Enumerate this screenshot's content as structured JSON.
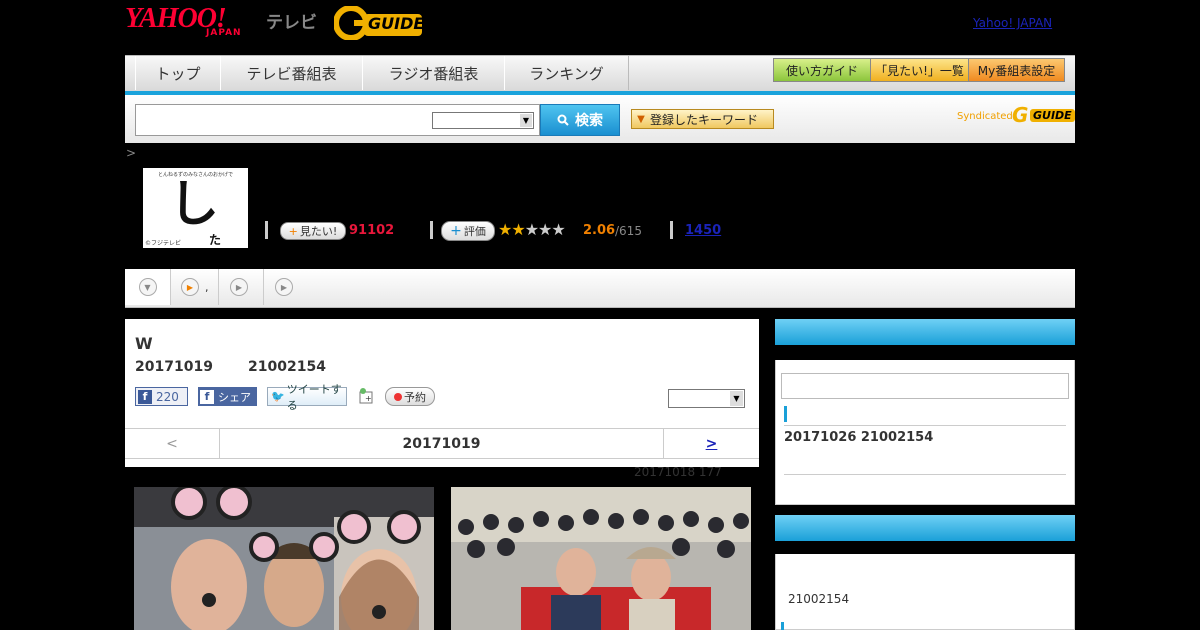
{
  "header": {
    "yahoo_logo": "YAHOO!",
    "japan_logo": "JAPAN",
    "tv_label": "テレビ",
    "gguide_logo": "GUIDE",
    "yahoo_japan_link": "Yahoo! JAPAN"
  },
  "nav": {
    "tabs": [
      {
        "label": "トップ"
      },
      {
        "label": "テレビ番組表"
      },
      {
        "label": "ラジオ番組表"
      },
      {
        "label": "ランキング"
      }
    ],
    "guide_buttons": [
      {
        "label": "使い方ガイド",
        "color": "#a8d84a"
      },
      {
        "label": "「見たい!」一覧",
        "color": "#f5c842"
      },
      {
        "label": "My番組表設定",
        "color": "#f5a030"
      }
    ]
  },
  "search": {
    "placeholder": "",
    "select_value": "",
    "button_label": "検索",
    "keyword_button": "登録したキーワード",
    "syndicated_label": "Syndicated",
    "syndicated_logo": "GUIDE"
  },
  "breadcrumb": ">",
  "program": {
    "thumb_caption_top": "とんねるずのみなさんのおかげで",
    "thumb_char": "し",
    "thumb_credit": "©フジテレビ",
    "mitai_label": "見たい!",
    "mitai_count": "91102",
    "rate_label": "評価",
    "stars": "★★★★★",
    "rating": "2.06",
    "rating_count": "/615",
    "review_count": "1450"
  },
  "subtabs": [
    {
      "label": "",
      "icon": "chevron-down-icon"
    },
    {
      "label": ",",
      "icon": "play-icon"
    },
    {
      "label": "",
      "icon": "play-icon"
    },
    {
      "label": "",
      "icon": "play-icon"
    }
  ],
  "episode": {
    "title": "W",
    "date": "20171019",
    "id": "21002154",
    "fb_like_count": "220",
    "fb_share_label": "シェア",
    "tweet_label": "ツイートする",
    "reserve_label": "予約",
    "select_value": ""
  },
  "date_nav": {
    "prev": "<",
    "current": "20171019",
    "next": ">"
  },
  "meta": "20171018  177",
  "sidebar": {
    "box1_text": "20171026  21002154",
    "box2_text": "21002154"
  },
  "colors": {
    "accent_blue": "#1aa3dc",
    "link_blue": "#1a23b8",
    "mitai_red": "#e8173b",
    "rating_orange": "#f08000"
  }
}
